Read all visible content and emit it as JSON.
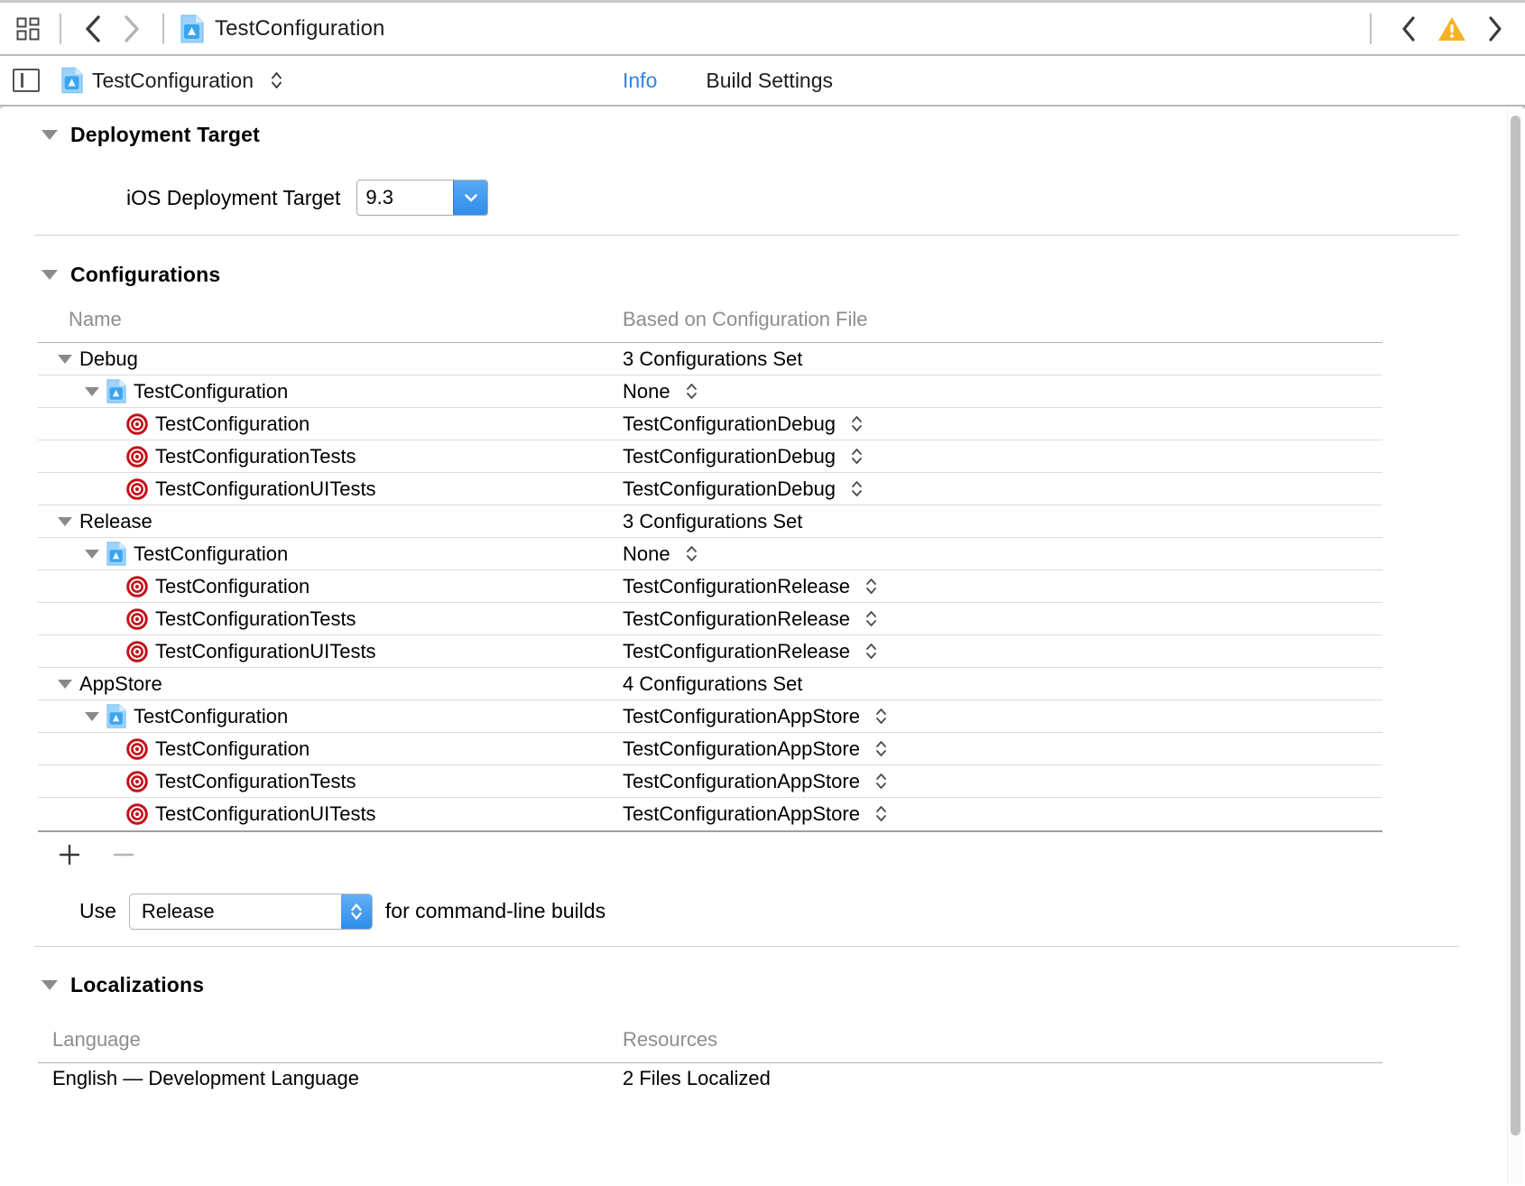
{
  "window": {
    "breadcrumb_title": "TestConfiguration",
    "scheme_title": "TestConfiguration",
    "warning_icon": "warning-triangle-icon",
    "grid_icon": "grid-view-icon",
    "back_icon": "chevron-left-icon",
    "forward_icon": "chevron-right-icon",
    "sidebar_toggle_icon": "sidebar-toggle-icon",
    "project_icon": "xcode-project-icon"
  },
  "tabs": [
    {
      "label": "Info",
      "active": true
    },
    {
      "label": "Build Settings",
      "active": false
    }
  ],
  "deployment_target": {
    "section_title": "Deployment Target",
    "field_label": "iOS Deployment Target",
    "value": "9.3"
  },
  "configurations": {
    "section_title": "Configurations",
    "columns": {
      "name": "Name",
      "value": "Based on Configuration File"
    },
    "rows": [
      {
        "indent": 0,
        "icon": "none",
        "name": "Debug",
        "value": "3 Configurations Set",
        "stepper": false
      },
      {
        "indent": 1,
        "icon": "project",
        "name": "TestConfiguration",
        "value": "None",
        "stepper": true,
        "disclosure": true
      },
      {
        "indent": 2,
        "icon": "target",
        "name": "TestConfiguration",
        "value": "TestConfigurationDebug",
        "stepper": true
      },
      {
        "indent": 2,
        "icon": "target",
        "name": "TestConfigurationTests",
        "value": "TestConfigurationDebug",
        "stepper": true
      },
      {
        "indent": 2,
        "icon": "target",
        "name": "TestConfigurationUITests",
        "value": "TestConfigurationDebug",
        "stepper": true
      },
      {
        "indent": 0,
        "icon": "none",
        "name": "Release",
        "value": "3 Configurations Set",
        "stepper": false
      },
      {
        "indent": 1,
        "icon": "project",
        "name": "TestConfiguration",
        "value": "None",
        "stepper": true,
        "disclosure": true
      },
      {
        "indent": 2,
        "icon": "target",
        "name": "TestConfiguration",
        "value": "TestConfigurationRelease",
        "stepper": true
      },
      {
        "indent": 2,
        "icon": "target",
        "name": "TestConfigurationTests",
        "value": "TestConfigurationRelease",
        "stepper": true
      },
      {
        "indent": 2,
        "icon": "target",
        "name": "TestConfigurationUITests",
        "value": "TestConfigurationRelease",
        "stepper": true
      },
      {
        "indent": 0,
        "icon": "none",
        "name": "AppStore",
        "value": "4 Configurations Set",
        "stepper": false
      },
      {
        "indent": 1,
        "icon": "project",
        "name": "TestConfiguration",
        "value": "TestConfigurationAppStore",
        "stepper": true,
        "disclosure": true
      },
      {
        "indent": 2,
        "icon": "target",
        "name": "TestConfiguration",
        "value": "TestConfigurationAppStore",
        "stepper": true
      },
      {
        "indent": 2,
        "icon": "target",
        "name": "TestConfigurationTests",
        "value": "TestConfigurationAppStore",
        "stepper": true
      },
      {
        "indent": 2,
        "icon": "target",
        "name": "TestConfigurationUITests",
        "value": "TestConfigurationAppStore",
        "stepper": true
      }
    ],
    "add_icon": "plus-icon",
    "remove_icon": "minus-icon",
    "command_line": {
      "prefix": "Use",
      "value": "Release",
      "suffix": "for command-line builds"
    }
  },
  "localizations": {
    "section_title": "Localizations",
    "columns": {
      "language": "Language",
      "resources": "Resources"
    },
    "rows": [
      {
        "language": "English — Development Language",
        "resources": "2 Files Localized"
      }
    ]
  },
  "colors": {
    "accent": "#2f84e8",
    "target_red": "#c0121c",
    "warning_yellow": "#f5b324",
    "muted_text": "#8e8e8e"
  }
}
